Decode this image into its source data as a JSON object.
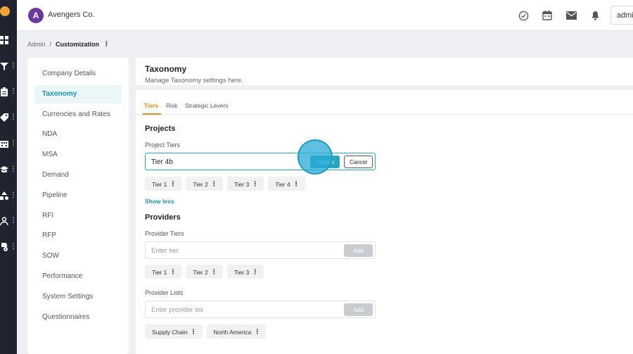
{
  "app": {
    "brand_name": "Avengers Co.",
    "brand_initial": "A",
    "user_label": "admi"
  },
  "breadcrumb": {
    "root": "Admin",
    "separator": "/",
    "current": "Customization",
    "more": "⋮"
  },
  "side_menu": {
    "items": [
      {
        "label": "Company Details",
        "active": false
      },
      {
        "label": "Taxonomy",
        "active": true
      },
      {
        "label": "Currencies and Rates",
        "active": false
      },
      {
        "label": "NDA",
        "active": false
      },
      {
        "label": "MSA",
        "active": false
      },
      {
        "label": "Demand",
        "active": false
      },
      {
        "label": "Pipeline",
        "active": false
      },
      {
        "label": "RFI",
        "active": false
      },
      {
        "label": "RFP",
        "active": false
      },
      {
        "label": "SOW",
        "active": false
      },
      {
        "label": "Performance",
        "active": false
      },
      {
        "label": "System Settings",
        "active": false
      },
      {
        "label": "Questionnaires",
        "active": false
      }
    ]
  },
  "page": {
    "title": "Taxonomy",
    "subtitle": "Manage Taxonomy settings here.",
    "tabs": [
      {
        "label": "Tiers",
        "active": true
      },
      {
        "label": "Risk",
        "active": false
      },
      {
        "label": "Strategic Levers",
        "active": false
      }
    ]
  },
  "projects": {
    "title": "Projects",
    "field_label": "Project Tiers",
    "input_value": "Tier 4b",
    "update_label": "Update",
    "cancel_label": "Cancel",
    "chips": [
      "Tier 1",
      "Tier 2",
      "Tier 3",
      "Tier 4"
    ],
    "show_less": "Show less"
  },
  "providers": {
    "title": "Providers",
    "tiers_label": "Provider Tiers",
    "tiers_placeholder": "Enter tier",
    "tiers_add": "Add",
    "tier_chips": [
      "Tier 1",
      "Tier 2",
      "Tier 3"
    ],
    "lists_label": "Provider Lists",
    "lists_placeholder": "Enter provider list",
    "lists_add": "Add",
    "list_chips": [
      "Supply Chain",
      "North America"
    ]
  },
  "chip_menu_glyph": "⋮",
  "colors": {
    "accent": "#2aa7c0",
    "tab_active": "#d98a20",
    "rail": "#1f2430",
    "brand": "#6a3a9a"
  },
  "icons": {
    "rail": [
      "dashboard-icon",
      "filter-icon",
      "clipboard-icon",
      "tag-icon",
      "building-icon",
      "graduation-cap-icon",
      "shapes-icon",
      "user-icon",
      "settings-icon"
    ],
    "topbar": [
      "check-circle-icon",
      "calendar-icon",
      "mail-icon",
      "bell-icon"
    ]
  }
}
